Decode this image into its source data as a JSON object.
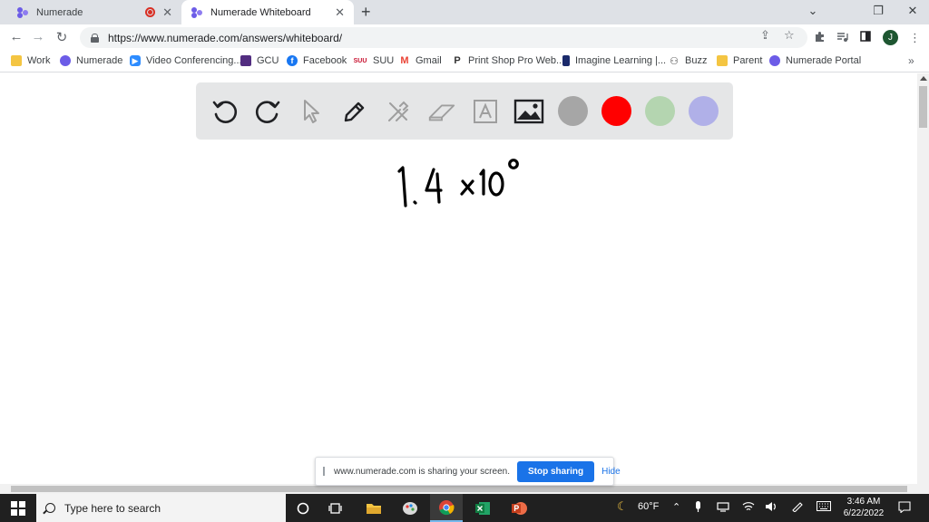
{
  "browser": {
    "tabs": [
      {
        "title": "Numerade",
        "recording": true,
        "active": false
      },
      {
        "title": "Numerade Whiteboard",
        "recording": false,
        "active": true
      }
    ],
    "new_tab_label": "+",
    "window_controls": {
      "minimize": "⌄",
      "restore": "❐",
      "close": "✕"
    },
    "url": "https://www.numerade.com/answers/whiteboard/",
    "profile_initial": "J"
  },
  "bookmarks": [
    {
      "label": "Work",
      "icon": "folder-icon",
      "color": "#f4c542"
    },
    {
      "label": "Numerade",
      "icon": "numerade-icon",
      "color": "#6c5ce7"
    },
    {
      "label": "Video Conferencing...",
      "icon": "video-icon",
      "color": "#2d8cff"
    },
    {
      "label": "GCU",
      "icon": "gcu-icon",
      "color": "#522d80"
    },
    {
      "label": "Facebook",
      "icon": "facebook-icon",
      "color": "#1877f2"
    },
    {
      "label": "SUU",
      "icon": "suu-icon",
      "color": "#c8102e"
    },
    {
      "label": "Gmail",
      "icon": "gmail-icon",
      "color": "#ea4335"
    },
    {
      "label": "Print Shop Pro Web...",
      "icon": "printshop-icon",
      "color": "#333333"
    },
    {
      "label": "Imagine Learning |...",
      "icon": "imagine-icon",
      "color": "#1b2a6b"
    },
    {
      "label": "Buzz",
      "icon": "buzz-icon",
      "color": "#444444"
    },
    {
      "label": "Parent",
      "icon": "folder-icon",
      "color": "#f4c542"
    },
    {
      "label": "Numerade Portal",
      "icon": "numerade-icon",
      "color": "#6c5ce7"
    }
  ],
  "bookmarks_more": "»",
  "whiteboard": {
    "tools": [
      "undo",
      "redo",
      "select",
      "pen",
      "tools",
      "eraser",
      "text",
      "image"
    ],
    "colors": [
      "#a6a6a6",
      "#ff0000",
      "#b4d5b0",
      "#b0b0e8"
    ],
    "written_expression": "1.4 ×10°"
  },
  "share_notice": {
    "text": "www.numerade.com is sharing your screen.",
    "stop_label": "Stop sharing",
    "hide_label": "Hide"
  },
  "taskbar": {
    "search_placeholder": "Type here to search",
    "weather": "60°F",
    "time": "3:46 AM",
    "date": "6/22/2022"
  }
}
